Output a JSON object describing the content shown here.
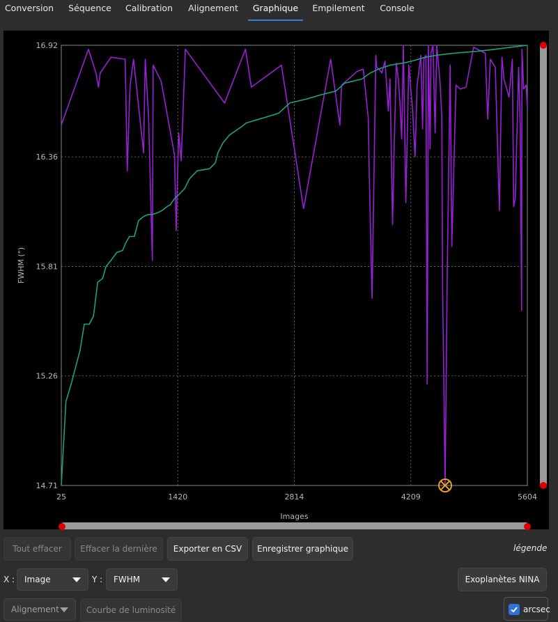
{
  "tabs": [
    {
      "label": "Conversion"
    },
    {
      "label": "Séquence"
    },
    {
      "label": "Calibration"
    },
    {
      "label": "Alignement"
    },
    {
      "label": "Graphique",
      "active": true
    },
    {
      "label": "Empilement"
    },
    {
      "label": "Console"
    }
  ],
  "plot": {
    "x_label": "Images",
    "y_label": "FWHM (\")"
  },
  "chart_data": {
    "type": "line",
    "xlabel": "Images",
    "ylabel": "FWHM (\")",
    "xlim": [
      25,
      5604
    ],
    "ylim": [
      14.71,
      16.92
    ],
    "x_ticks": [
      "25",
      "1420",
      "2814",
      "4209",
      "5604"
    ],
    "y_ticks": [
      "14.71",
      "15.26",
      "15.81",
      "16.36",
      "16.92"
    ],
    "grid": true,
    "colors": {
      "raw": "#9a1fd8",
      "sorted": "#1aa37a",
      "marker": "#e8a317",
      "background": "#000000"
    },
    "series": [
      {
        "color": "#9a1fd8",
        "points": [
          [
            25,
            16.52
          ],
          [
            350,
            16.9
          ],
          [
            440,
            16.78
          ],
          [
            470,
            16.71
          ],
          [
            490,
            16.78
          ],
          [
            620,
            16.86
          ],
          [
            790,
            16.85
          ],
          [
            815,
            16.29
          ],
          [
            840,
            16.62
          ],
          [
            850,
            16.72
          ],
          [
            890,
            16.85
          ],
          [
            1010,
            16.38
          ],
          [
            1030,
            16.85
          ],
          [
            1070,
            16.56
          ],
          [
            1115,
            15.84
          ],
          [
            1125,
            16.82
          ],
          [
            1220,
            16.74
          ],
          [
            1380,
            16.37
          ],
          [
            1400,
            15.99
          ],
          [
            1430,
            16.48
          ],
          [
            1460,
            16.34
          ],
          [
            1510,
            16.9
          ],
          [
            1980,
            16.63
          ],
          [
            2230,
            16.9
          ],
          [
            2300,
            16.71
          ],
          [
            2660,
            16.82
          ],
          [
            2925,
            16.1
          ],
          [
            3250,
            16.85
          ],
          [
            3360,
            16.52
          ],
          [
            3380,
            16.72
          ],
          [
            3570,
            16.79
          ],
          [
            3640,
            16.8
          ],
          [
            3700,
            16.55
          ],
          [
            3710,
            16.3
          ],
          [
            3745,
            15.65
          ],
          [
            3790,
            16.87
          ],
          [
            3800,
            16.81
          ],
          [
            3850,
            16.79
          ],
          [
            3860,
            16.78
          ],
          [
            3900,
            16.84
          ],
          [
            3940,
            16.59
          ],
          [
            3960,
            16.75
          ],
          [
            3990,
            16.02
          ],
          [
            4010,
            16.42
          ],
          [
            4035,
            16.83
          ],
          [
            4060,
            16.75
          ],
          [
            4080,
            16.62
          ],
          [
            4100,
            16.45
          ],
          [
            4120,
            16.92
          ],
          [
            4150,
            16.13
          ],
          [
            4185,
            16.82
          ],
          [
            4230,
            16.6
          ],
          [
            4260,
            16.36
          ],
          [
            4285,
            16.72
          ],
          [
            4330,
            16.87
          ],
          [
            4350,
            16.5
          ],
          [
            4365,
            16.85
          ],
          [
            4390,
            16.87
          ],
          [
            4405,
            15.22
          ],
          [
            4420,
            16.92
          ],
          [
            4440,
            16.4
          ],
          [
            4450,
            16.88
          ],
          [
            4475,
            16.92
          ],
          [
            4500,
            16.48
          ],
          [
            4520,
            16.92
          ],
          [
            4560,
            16.73
          ],
          [
            4580,
            16.56
          ],
          [
            4590,
            15.69
          ],
          [
            4620,
            14.71
          ],
          [
            4645,
            15.77
          ],
          [
            4680,
            16.82
          ],
          [
            4700,
            15.91
          ],
          [
            4750,
            16.72
          ],
          [
            4800,
            16.7
          ],
          [
            4870,
            16.71
          ],
          [
            4960,
            16.91
          ],
          [
            5100,
            16.88
          ],
          [
            5130,
            16.55
          ],
          [
            5160,
            16.85
          ],
          [
            5220,
            16.81
          ],
          [
            5270,
            16.09
          ],
          [
            5300,
            16.86
          ],
          [
            5325,
            16.75
          ],
          [
            5385,
            16.66
          ],
          [
            5425,
            16.85
          ],
          [
            5440,
            16.11
          ],
          [
            5460,
            16.15
          ],
          [
            5500,
            16.81
          ],
          [
            5520,
            16.5
          ],
          [
            5535,
            15.59
          ],
          [
            5540,
            16.9
          ],
          [
            5560,
            16.7
          ],
          [
            5590,
            16.72
          ],
          [
            5604,
            16.61
          ]
        ]
      },
      {
        "color": "#1aa37a",
        "points": [
          [
            25,
            14.71
          ],
          [
            80,
            15.13
          ],
          [
            150,
            15.23
          ],
          [
            250,
            15.39
          ],
          [
            300,
            15.52
          ],
          [
            360,
            15.52
          ],
          [
            410,
            15.56
          ],
          [
            460,
            15.73
          ],
          [
            520,
            15.75
          ],
          [
            560,
            15.81
          ],
          [
            620,
            15.84
          ],
          [
            690,
            15.88
          ],
          [
            760,
            15.89
          ],
          [
            800,
            15.93
          ],
          [
            840,
            15.96
          ],
          [
            900,
            15.96
          ],
          [
            950,
            16.04
          ],
          [
            1010,
            16.06
          ],
          [
            1060,
            16.07
          ],
          [
            1110,
            16.07
          ],
          [
            1180,
            16.08
          ],
          [
            1230,
            16.09
          ],
          [
            1290,
            16.11
          ],
          [
            1330,
            16.12
          ],
          [
            1380,
            16.15
          ],
          [
            1430,
            16.17
          ],
          [
            1500,
            16.2
          ],
          [
            1560,
            16.25
          ],
          [
            1650,
            16.29
          ],
          [
            1800,
            16.3
          ],
          [
            1870,
            16.33
          ],
          [
            1900,
            16.38
          ],
          [
            1960,
            16.43
          ],
          [
            2040,
            16.47
          ],
          [
            2180,
            16.51
          ],
          [
            2240,
            16.53
          ],
          [
            2400,
            16.55
          ],
          [
            2560,
            16.57
          ],
          [
            2630,
            16.58
          ],
          [
            2760,
            16.63
          ],
          [
            2960,
            16.65
          ],
          [
            3120,
            16.67
          ],
          [
            3310,
            16.69
          ],
          [
            3420,
            16.73
          ],
          [
            3620,
            16.75
          ],
          [
            3720,
            16.78
          ],
          [
            3820,
            16.8
          ],
          [
            3960,
            16.82
          ],
          [
            4110,
            16.83
          ],
          [
            4220,
            16.84
          ],
          [
            4380,
            16.86
          ],
          [
            4520,
            16.87
          ],
          [
            4720,
            16.88
          ],
          [
            5010,
            16.89
          ],
          [
            5220,
            16.9
          ],
          [
            5400,
            16.91
          ],
          [
            5604,
            16.92
          ]
        ]
      }
    ],
    "selected_point": {
      "x": 4620,
      "y": 14.71
    }
  },
  "buttons": {
    "clear_all": "Tout effacer",
    "clear_last": "Effacer la dernière",
    "export_csv": "Exporter en CSV",
    "save_graph": "Enregistrer graphique",
    "nina_exoplanets": "Exoplanètes NINA",
    "light_curve": "Courbe de luminosité"
  },
  "legend_label": "légende",
  "x_selector": {
    "label": "X :",
    "value": "Image"
  },
  "y_selector": {
    "label": "Y :",
    "value": "FWHM"
  },
  "mode_selector": {
    "value": "Alignement"
  },
  "arcsec": {
    "label": "arcsec",
    "checked": true
  }
}
